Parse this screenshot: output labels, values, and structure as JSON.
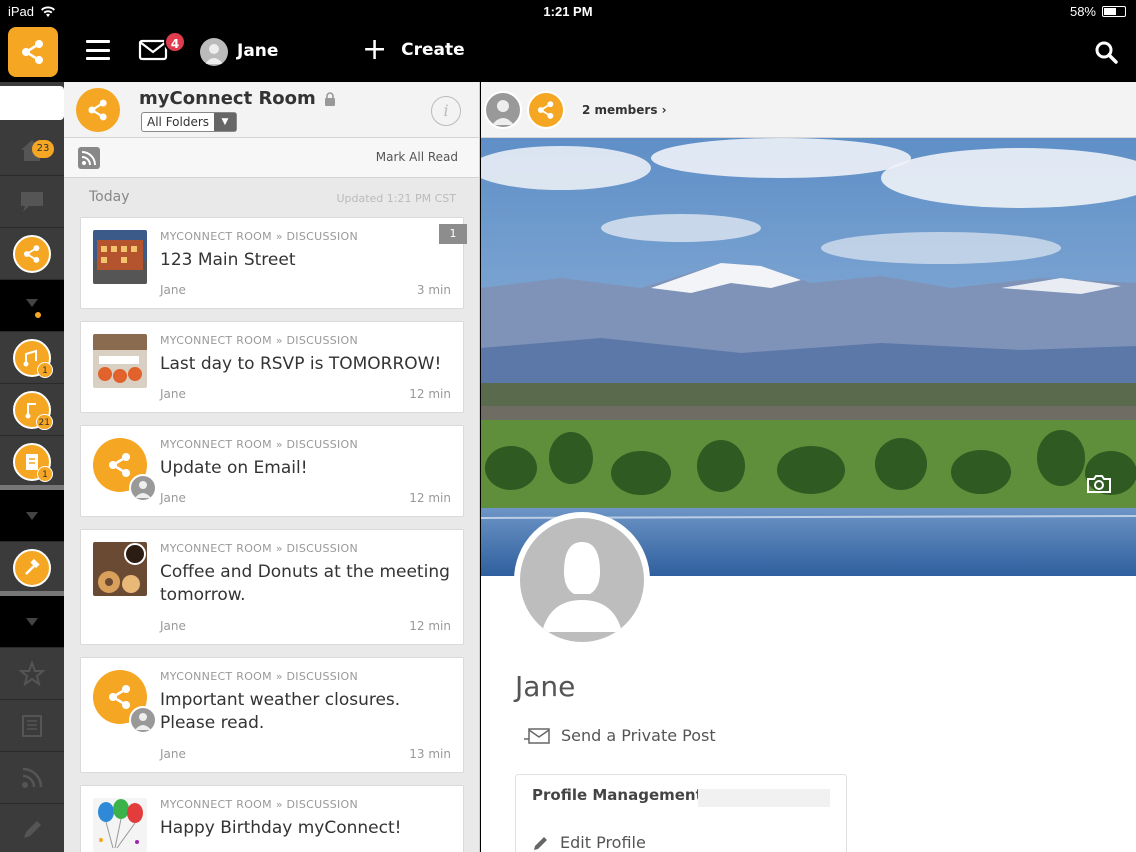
{
  "status_bar": {
    "device": "iPad",
    "time": "1:21 PM",
    "battery": "58%"
  },
  "top_nav": {
    "mail_badge": "4",
    "user_name": "Jane",
    "create_label": "Create"
  },
  "rail": {
    "home_badge": "23",
    "room_badges": [
      "1",
      "21",
      "1"
    ]
  },
  "room": {
    "title": "myConnect Room",
    "folder_select": "All Folders",
    "info_icon": "i"
  },
  "feed": {
    "mark_all_read": "Mark All Read",
    "today_label": "Today",
    "updated_label": "Updated 1:21 PM CST",
    "items": [
      {
        "crumb": "MYCONNECT ROOM » DISCUSSION",
        "title": "123 Main Street",
        "author": "Jane",
        "time": "3 min",
        "count": "1"
      },
      {
        "crumb": "MYCONNECT ROOM » DISCUSSION",
        "title": "Last day to RSVP is TOMORROW!",
        "author": "Jane",
        "time": "12 min"
      },
      {
        "crumb": "MYCONNECT ROOM » DISCUSSION",
        "title": "Update on Email!",
        "author": "Jane",
        "time": "12 min"
      },
      {
        "crumb": "MYCONNECT ROOM » DISCUSSION",
        "title": "Coffee and Donuts at the meeting tomorrow.",
        "author": "Jane",
        "time": "12 min"
      },
      {
        "crumb": "MYCONNECT ROOM » DISCUSSION",
        "title": "Important weather closures. Please read.",
        "author": "Jane",
        "time": "13 min"
      },
      {
        "crumb": "MYCONNECT ROOM » DISCUSSION",
        "title": "Happy Birthday myConnect!"
      }
    ]
  },
  "profile": {
    "members_link": "2 members ›",
    "name": "Jane",
    "private_post": "Send a Private Post",
    "management_title": "Profile Management",
    "edit_profile": "Edit Profile"
  },
  "colors": {
    "accent": "#f5a623",
    "badge": "#e03c4d",
    "rail": "#3b3b3b"
  }
}
